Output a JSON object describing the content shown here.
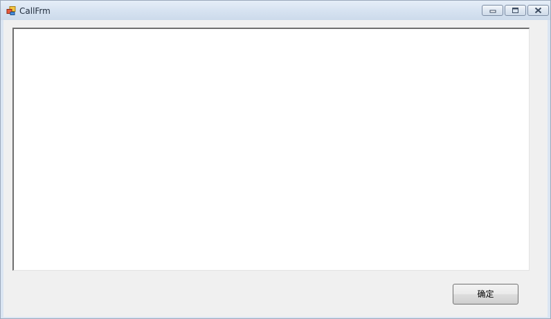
{
  "window": {
    "title": "CallFrm",
    "icon": "app-window-icon",
    "controls": [
      "minimize-icon",
      "maximize-icon",
      "close-icon"
    ]
  },
  "main": {
    "text_area": {
      "value": "",
      "placeholder": ""
    },
    "ok_button_label": "确定"
  },
  "colors": {
    "titlebar": "#d7e3f1",
    "client_background": "#f0f0f0",
    "text_area_background": "#ffffff"
  }
}
